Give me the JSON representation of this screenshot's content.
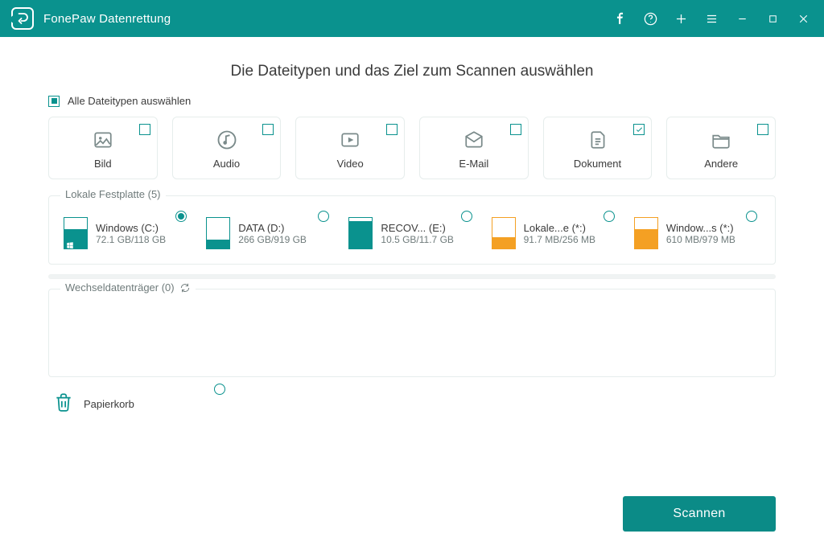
{
  "app": {
    "title": "FonePaw Datenrettung"
  },
  "heading": "Die Dateitypen und das Ziel zum Scannen auswählen",
  "selectAll": {
    "label": "Alle Dateitypen auswählen",
    "state": "partial"
  },
  "types": [
    {
      "key": "image",
      "label": "Bild",
      "checked": false
    },
    {
      "key": "audio",
      "label": "Audio",
      "checked": false
    },
    {
      "key": "video",
      "label": "Video",
      "checked": false
    },
    {
      "key": "email",
      "label": "E-Mail",
      "checked": false
    },
    {
      "key": "document",
      "label": "Dokument",
      "checked": true
    },
    {
      "key": "other",
      "label": "Andere",
      "checked": false
    }
  ],
  "localDisks": {
    "title": "Lokale Festplatte (5)",
    "items": [
      {
        "name": "Windows (C:)",
        "size": "72.1 GB/118 GB",
        "fillPct": 62,
        "color": "teal",
        "selected": true,
        "os": true
      },
      {
        "name": "DATA (D:)",
        "size": "266 GB/919 GB",
        "fillPct": 28,
        "color": "teal",
        "selected": false,
        "os": false
      },
      {
        "name": "RECOV... (E:)",
        "size": "10.5 GB/11.7 GB",
        "fillPct": 90,
        "color": "teal",
        "selected": false,
        "os": false
      },
      {
        "name": "Lokale...e (*:)",
        "size": "91.7 MB/256 MB",
        "fillPct": 36,
        "color": "orange",
        "selected": false,
        "os": false
      },
      {
        "name": "Window...s (*:)",
        "size": "610 MB/979 MB",
        "fillPct": 62,
        "color": "orange",
        "selected": false,
        "os": false
      }
    ]
  },
  "removable": {
    "title": "Wechseldatenträger (0)"
  },
  "recycleBin": {
    "label": "Papierkorb",
    "selected": false
  },
  "scanButton": "Scannen"
}
